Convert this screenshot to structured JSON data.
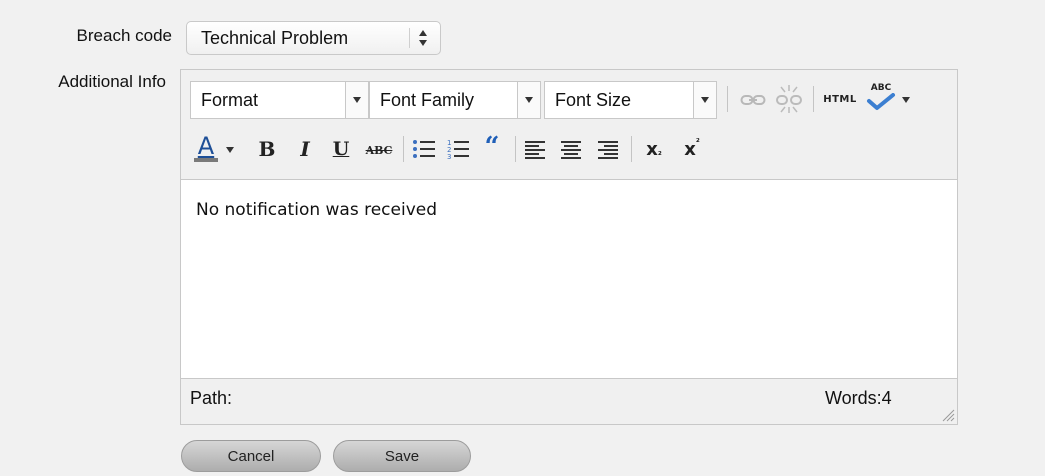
{
  "breach": {
    "label": "Breach code",
    "value": "Technical Problem"
  },
  "info": {
    "label": "Additional Info"
  },
  "toolbar": {
    "format": "Format",
    "font_family": "Font Family",
    "font_size": "Font Size",
    "html_label": "HTML",
    "spell_label": "ABC",
    "bold": "B",
    "italic": "I",
    "underline": "U",
    "strike": "ABC",
    "blockquote": "“",
    "subscript": "x",
    "superscript": "x"
  },
  "editor": {
    "content": "No notification was received",
    "path_label": "Path:",
    "words_label": "Words:4"
  },
  "buttons": {
    "cancel": "Cancel",
    "save": "Save"
  },
  "colors": {
    "page_background": "#f1f1f1",
    "toolbar_background": "#f0f0f0",
    "button_gradient_top": "#d6d6d6",
    "button_gradient_bottom": "#adadad",
    "text_color_bar": "#7a7a7a",
    "blockquote_blue": "#1f5fb8"
  }
}
